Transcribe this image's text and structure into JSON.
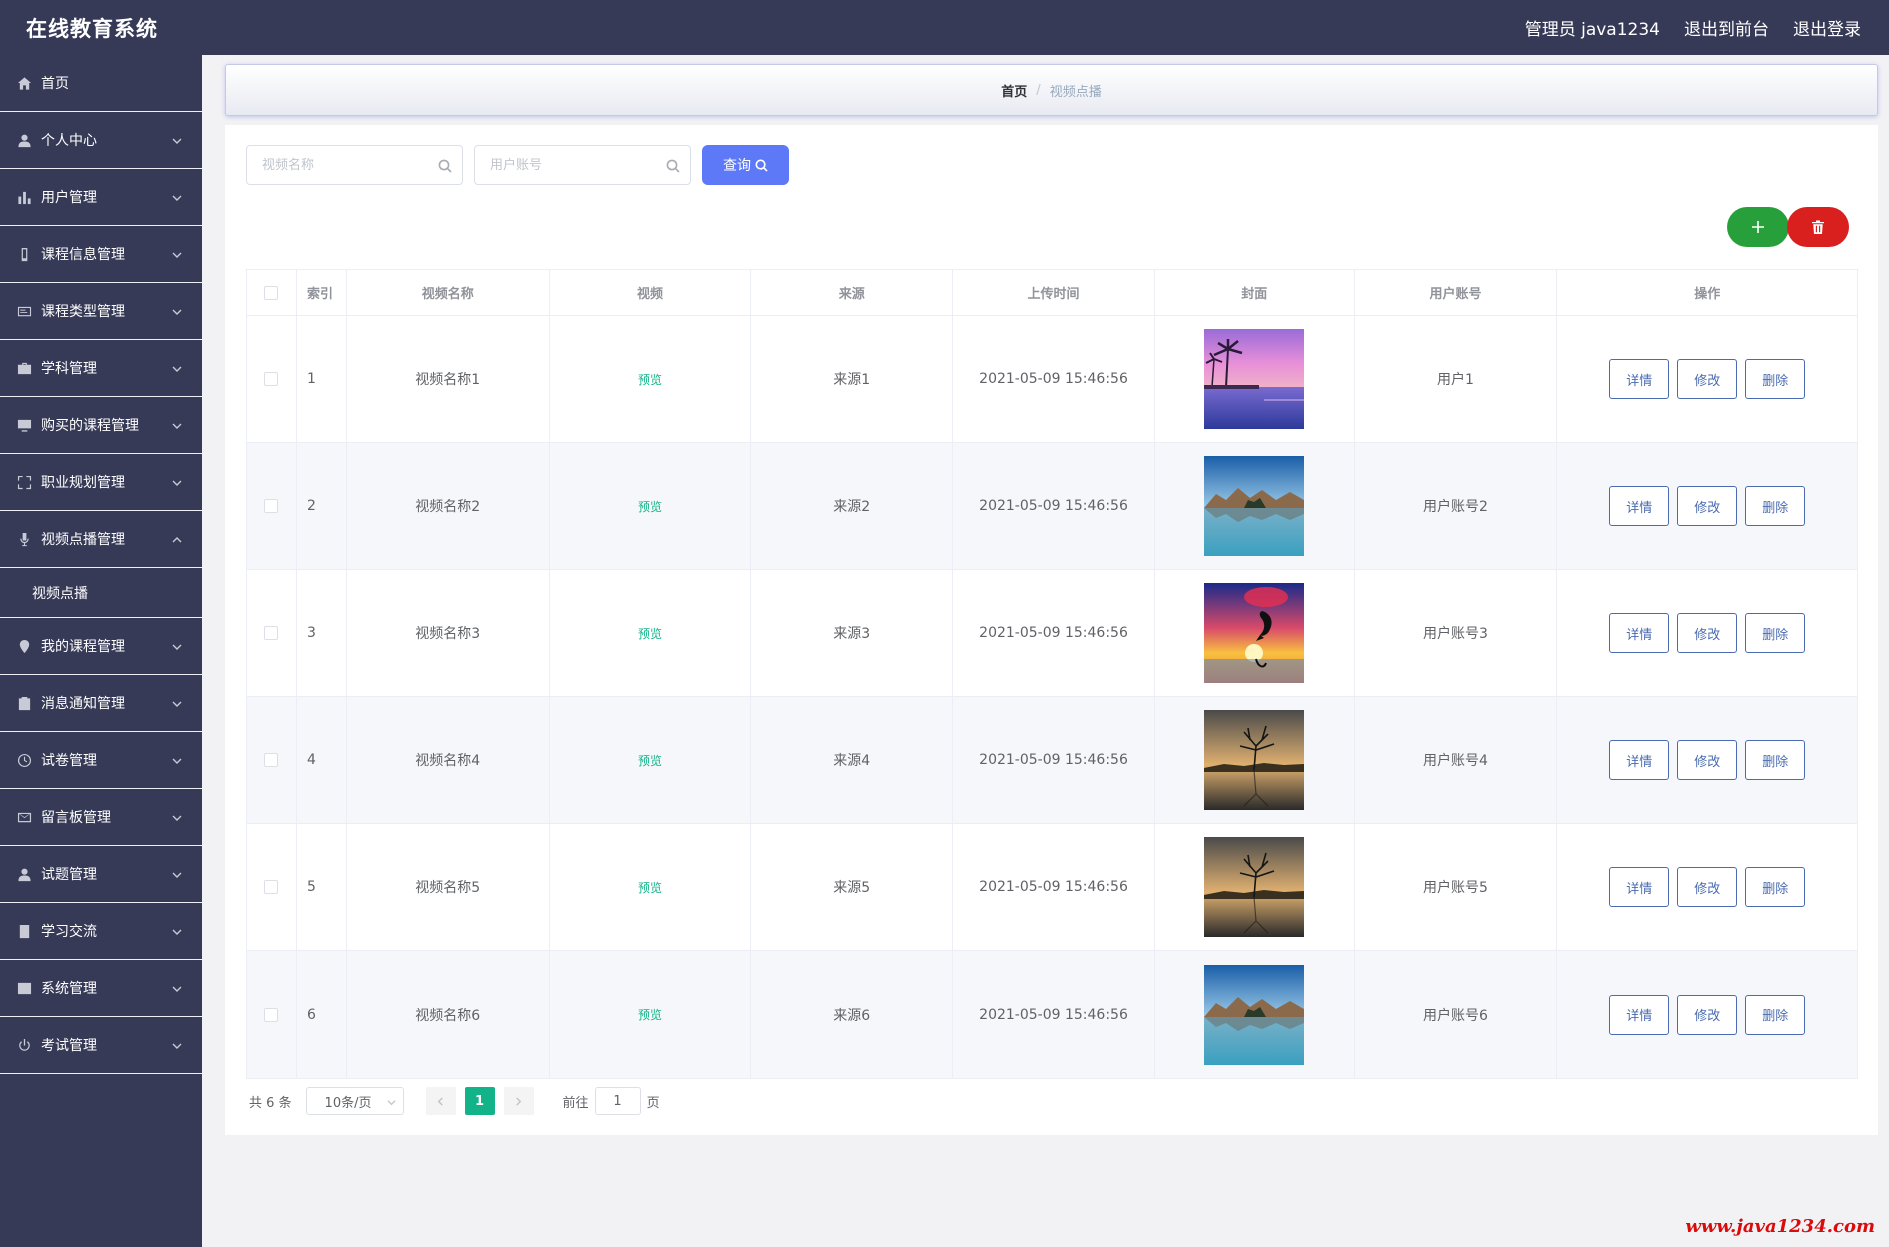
{
  "app": {
    "title": "在线教育系统",
    "user_label": "管理员 java1234",
    "to_front": "退出到前台",
    "logout": "退出登录"
  },
  "sidebar": {
    "items": [
      {
        "label": "首页",
        "icon": "home-icon",
        "has_arrow": false
      },
      {
        "label": "个人中心",
        "icon": "user-icon",
        "has_arrow": true
      },
      {
        "label": "用户管理",
        "icon": "bar-chart-icon",
        "has_arrow": true
      },
      {
        "label": "课程信息管理",
        "icon": "phone-icon",
        "has_arrow": true
      },
      {
        "label": "课程类型管理",
        "icon": "card-icon",
        "has_arrow": true
      },
      {
        "label": "学科管理",
        "icon": "briefcase-icon",
        "has_arrow": true
      },
      {
        "label": "购买的课程管理",
        "icon": "monitor-icon",
        "has_arrow": true
      },
      {
        "label": "职业规划管理",
        "icon": "fullscreen-icon",
        "has_arrow": true
      },
      {
        "label": "视频点播管理",
        "icon": "microphone-icon",
        "has_arrow": true,
        "expanded": true,
        "children": [
          {
            "label": "视频点播"
          }
        ]
      },
      {
        "label": "我的课程管理",
        "icon": "location-icon",
        "has_arrow": true
      },
      {
        "label": "消息通知管理",
        "icon": "clipboard-icon",
        "has_arrow": true
      },
      {
        "label": "试卷管理",
        "icon": "clock-icon",
        "has_arrow": true
      },
      {
        "label": "留言板管理",
        "icon": "mail-icon",
        "has_arrow": true
      },
      {
        "label": "试题管理",
        "icon": "user-icon",
        "has_arrow": true
      },
      {
        "label": "学习交流",
        "icon": "document-icon",
        "has_arrow": true
      },
      {
        "label": "系统管理",
        "icon": "trend-icon",
        "has_arrow": true
      },
      {
        "label": "考试管理",
        "icon": "power-icon",
        "has_arrow": true
      }
    ]
  },
  "breadcrumb": {
    "home": "首页",
    "sep": "/",
    "current": "视频点播"
  },
  "search": {
    "name_placeholder": "视频名称",
    "account_placeholder": "用户账号",
    "query_label": "查询"
  },
  "table": {
    "headers": {
      "index": "索引",
      "name": "视频名称",
      "video": "视频",
      "source": "来源",
      "time": "上传时间",
      "cover": "封面",
      "account": "用户账号",
      "ops": "操作"
    },
    "rows": [
      {
        "index": "1",
        "name": "视频名称1",
        "video": "预览",
        "source": "来源1",
        "time": "2021-05-09 15:46:56",
        "cover": "sunset-pool",
        "account": "用户1"
      },
      {
        "index": "2",
        "name": "视频名称2",
        "video": "预览",
        "source": "来源2",
        "time": "2021-05-09 15:46:56",
        "cover": "lake-mountains",
        "account": "用户账号2"
      },
      {
        "index": "3",
        "name": "视频名称3",
        "video": "预览",
        "source": "来源3",
        "time": "2021-05-09 15:46:56",
        "cover": "dolphin-sunset",
        "account": "用户账号3"
      },
      {
        "index": "4",
        "name": "视频名称4",
        "video": "预览",
        "source": "来源4",
        "time": "2021-05-09 15:46:56",
        "cover": "lone-tree",
        "account": "用户账号4"
      },
      {
        "index": "5",
        "name": "视频名称5",
        "video": "预览",
        "source": "来源5",
        "time": "2021-05-09 15:46:56",
        "cover": "lone-tree",
        "account": "用户账号5"
      },
      {
        "index": "6",
        "name": "视频名称6",
        "video": "预览",
        "source": "来源6",
        "time": "2021-05-09 15:46:56",
        "cover": "lake-mountains",
        "account": "用户账号6"
      }
    ],
    "op_labels": {
      "detail": "详情",
      "edit": "修改",
      "delete": "删除"
    }
  },
  "pagination": {
    "total": "共 6 条",
    "page_size": "10条/页",
    "current_page": "1",
    "goto_prefix": "前往",
    "goto_value": "1",
    "goto_suffix": "页"
  },
  "watermark": "www.java1234.com",
  "colors": {
    "header_bg": "#363a57",
    "sidebar_bg": "#363a57",
    "query_btn": "#5d79f7",
    "add_btn": "#27a03c",
    "delete_btn": "#d9201e",
    "preview_text": "#13b38a",
    "op_btn_border": "#4a6bb0",
    "active_page": "#13b38a",
    "watermark": "#d80c0c"
  }
}
